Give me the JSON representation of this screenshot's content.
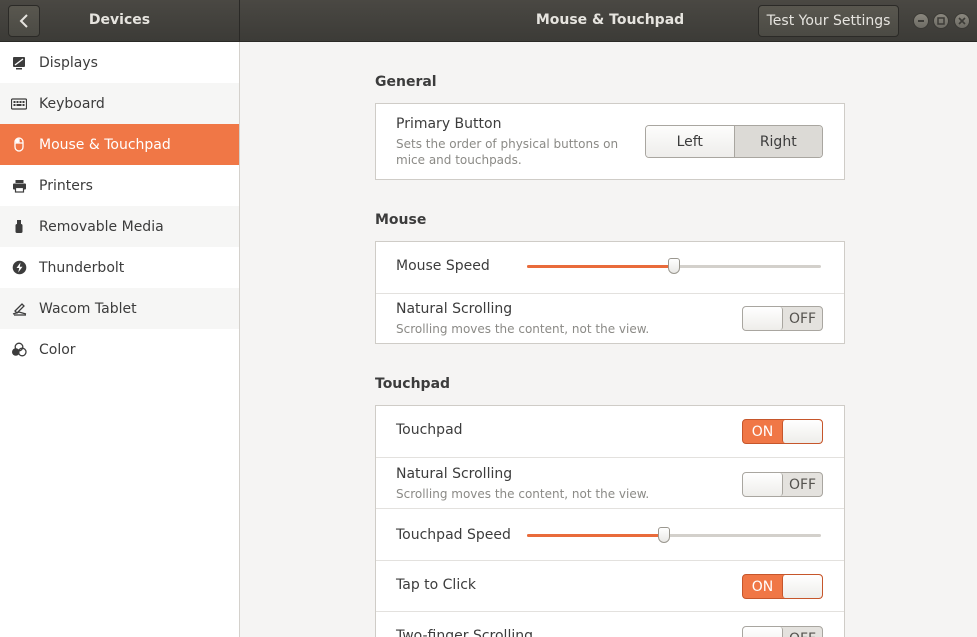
{
  "header": {
    "left_title": "Devices",
    "main_title": "Mouse & Touchpad",
    "test_button": "Test Your Settings"
  },
  "sidebar": {
    "items": [
      {
        "label": "Displays",
        "icon": "display-icon"
      },
      {
        "label": "Keyboard",
        "icon": "keyboard-icon"
      },
      {
        "label": "Mouse & Touchpad",
        "icon": "mouse-icon",
        "active": true
      },
      {
        "label": "Printers",
        "icon": "printer-icon"
      },
      {
        "label": "Removable Media",
        "icon": "usb-drive-icon"
      },
      {
        "label": "Thunderbolt",
        "icon": "thunderbolt-icon"
      },
      {
        "label": "Wacom Tablet",
        "icon": "tablet-icon"
      },
      {
        "label": "Color",
        "icon": "color-icon"
      }
    ]
  },
  "general": {
    "title": "General",
    "primary_button": {
      "label": "Primary Button",
      "description": "Sets the order of physical buttons on mice and touchpads.",
      "options": [
        "Left",
        "Right"
      ],
      "selected": "Right"
    }
  },
  "mouse": {
    "title": "Mouse",
    "speed": {
      "label": "Mouse Speed",
      "value": 0.5
    },
    "natural_scrolling": {
      "label": "Natural Scrolling",
      "description": "Scrolling moves the content, not the view.",
      "state": "OFF"
    }
  },
  "touchpad": {
    "title": "Touchpad",
    "enabled": {
      "label": "Touchpad",
      "state": "ON"
    },
    "natural_scrolling": {
      "label": "Natural Scrolling",
      "description": "Scrolling moves the content, not the view.",
      "state": "OFF"
    },
    "speed": {
      "label": "Touchpad Speed",
      "value": 0.465
    },
    "tap_to_click": {
      "label": "Tap to Click",
      "state": "ON"
    },
    "two_finger_scrolling": {
      "label": "Two-finger Scrolling",
      "state": "OFF"
    }
  },
  "colors": {
    "accent": "#f07746",
    "header_bg": "#3c3b37"
  }
}
